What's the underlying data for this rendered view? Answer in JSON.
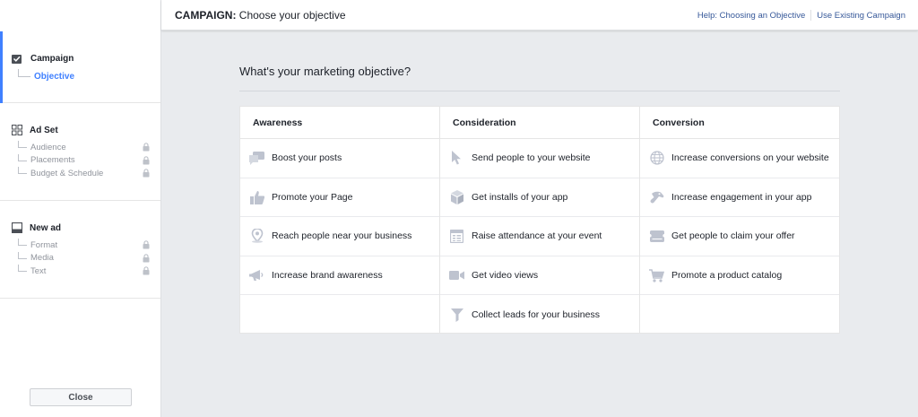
{
  "topbar": {
    "title_bold": "CAMPAIGN:",
    "title_rest": " Choose your objective",
    "help_link": "Help: Choosing an Objective",
    "existing_link": "Use Existing Campaign"
  },
  "sidebar": {
    "campaign": {
      "label": "Campaign",
      "items": [
        {
          "label": "Objective"
        }
      ]
    },
    "adset": {
      "label": "Ad Set",
      "items": [
        {
          "label": "Audience"
        },
        {
          "label": "Placements"
        },
        {
          "label": "Budget & Schedule"
        }
      ]
    },
    "newad": {
      "label": "New ad",
      "items": [
        {
          "label": "Format"
        },
        {
          "label": "Media"
        },
        {
          "label": "Text"
        }
      ]
    },
    "close_label": "Close"
  },
  "main": {
    "heading": "What's your marketing objective?",
    "columns": [
      {
        "title": "Awareness",
        "objectives": [
          {
            "label": "Boost your posts",
            "icon": "speech-bubbles-icon"
          },
          {
            "label": "Promote your Page",
            "icon": "thumbs-up-icon"
          },
          {
            "label": "Reach people near your business",
            "icon": "map-pin-icon"
          },
          {
            "label": "Increase brand awareness",
            "icon": "megaphone-icon"
          }
        ]
      },
      {
        "title": "Consideration",
        "objectives": [
          {
            "label": "Send people to your website",
            "icon": "cursor-icon"
          },
          {
            "label": "Get installs of your app",
            "icon": "box-icon"
          },
          {
            "label": "Raise attendance at your event",
            "icon": "calendar-icon"
          },
          {
            "label": "Get video views",
            "icon": "video-camera-icon"
          },
          {
            "label": "Collect leads for your business",
            "icon": "funnel-icon"
          }
        ]
      },
      {
        "title": "Conversion",
        "objectives": [
          {
            "label": "Increase conversions on your website",
            "icon": "globe-icon"
          },
          {
            "label": "Increase engagement in your app",
            "icon": "game-controller-icon"
          },
          {
            "label": "Get people to claim your offer",
            "icon": "offer-tag-icon"
          },
          {
            "label": "Promote a product catalog",
            "icon": "shopping-cart-icon"
          }
        ]
      }
    ]
  },
  "colors": {
    "accent": "#4080ff",
    "link": "#365899",
    "icon": "#bec3cf",
    "background": "#e9ebee"
  }
}
